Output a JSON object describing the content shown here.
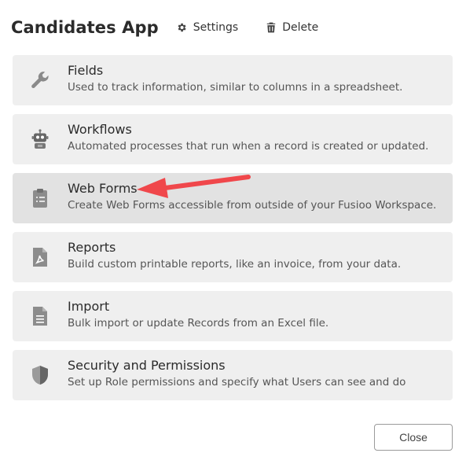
{
  "header": {
    "title": "Candidates App",
    "settings_label": "Settings",
    "settings_icon": "gear-icon",
    "delete_label": "Delete",
    "delete_icon": "trash-icon"
  },
  "items": [
    {
      "title": "Fields",
      "description": "Used to track information, similar to columns in a spreadsheet.",
      "icon": "wrench-icon"
    },
    {
      "title": "Workflows",
      "description": "Automated processes that run when a record is created or updated.",
      "icon": "robot-icon"
    },
    {
      "title": "Web Forms",
      "description": "Create Web Forms accessible from outside of your Fusioo Workspace.",
      "icon": "clipboard-icon",
      "highlighted": true
    },
    {
      "title": "Reports",
      "description": "Build custom printable reports, like an invoice, from your data.",
      "icon": "pdf-file-icon"
    },
    {
      "title": "Import",
      "description": "Bulk import or update Records from an Excel file.",
      "icon": "document-icon"
    },
    {
      "title": "Security and Permissions",
      "description": "Set up Role permissions and specify what Users can see and do",
      "icon": "shield-icon"
    }
  ],
  "annotation": {
    "arrow_color": "#f0474b",
    "points_to": "Web Forms"
  },
  "footer": {
    "close_label": "Close"
  }
}
